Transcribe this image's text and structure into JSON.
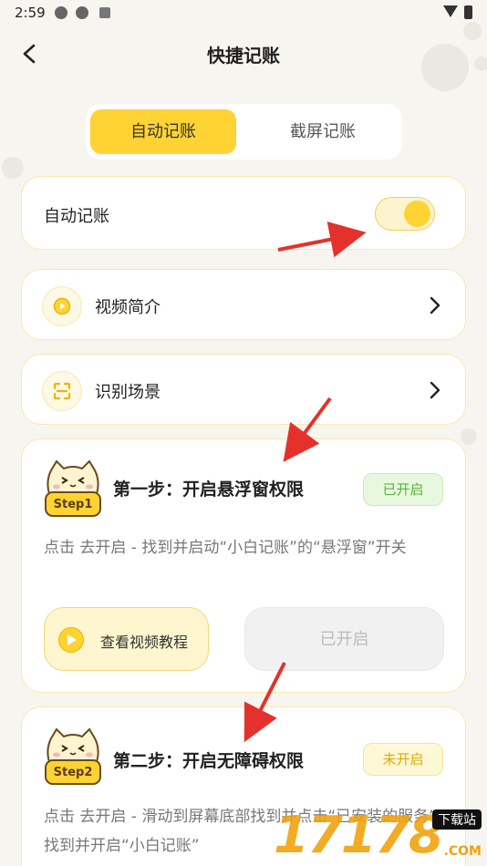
{
  "status_bar": {
    "time": "2:59"
  },
  "header": {
    "title": "快捷记账"
  },
  "tabs": [
    {
      "label": "自动记账",
      "active": true
    },
    {
      "label": "截屏记账",
      "active": false
    }
  ],
  "auto_record": {
    "label": "自动记账",
    "toggle_on": true
  },
  "menu": [
    {
      "label": "视频简介",
      "icon": "play-circle-icon"
    },
    {
      "label": "识别场景",
      "icon": "scan-icon"
    }
  ],
  "step1": {
    "cat_tag": "Step1",
    "title": "第一步：开启悬浮窗权限",
    "status": "已开启",
    "desc": "点击 去开启 - 找到并启动“小白记账”的“悬浮窗”开关",
    "video_button": "查看视频教程",
    "action_button": "已开启"
  },
  "step2": {
    "cat_tag": "Step2",
    "title": "第二步：开启无障碍权限",
    "status": "未开启",
    "desc": "点击 去开启 - 滑动到屏幕底部找到并点击“已安装的服务” - 找到并开启“小白记账”"
  },
  "watermark": {
    "logo": "17178",
    "tag": "下载站",
    "domain": ".COM"
  },
  "colors": {
    "accent": "#fed333",
    "success": "#56b43a",
    "warning": "#e0a800",
    "arrow": "#e5312b"
  }
}
